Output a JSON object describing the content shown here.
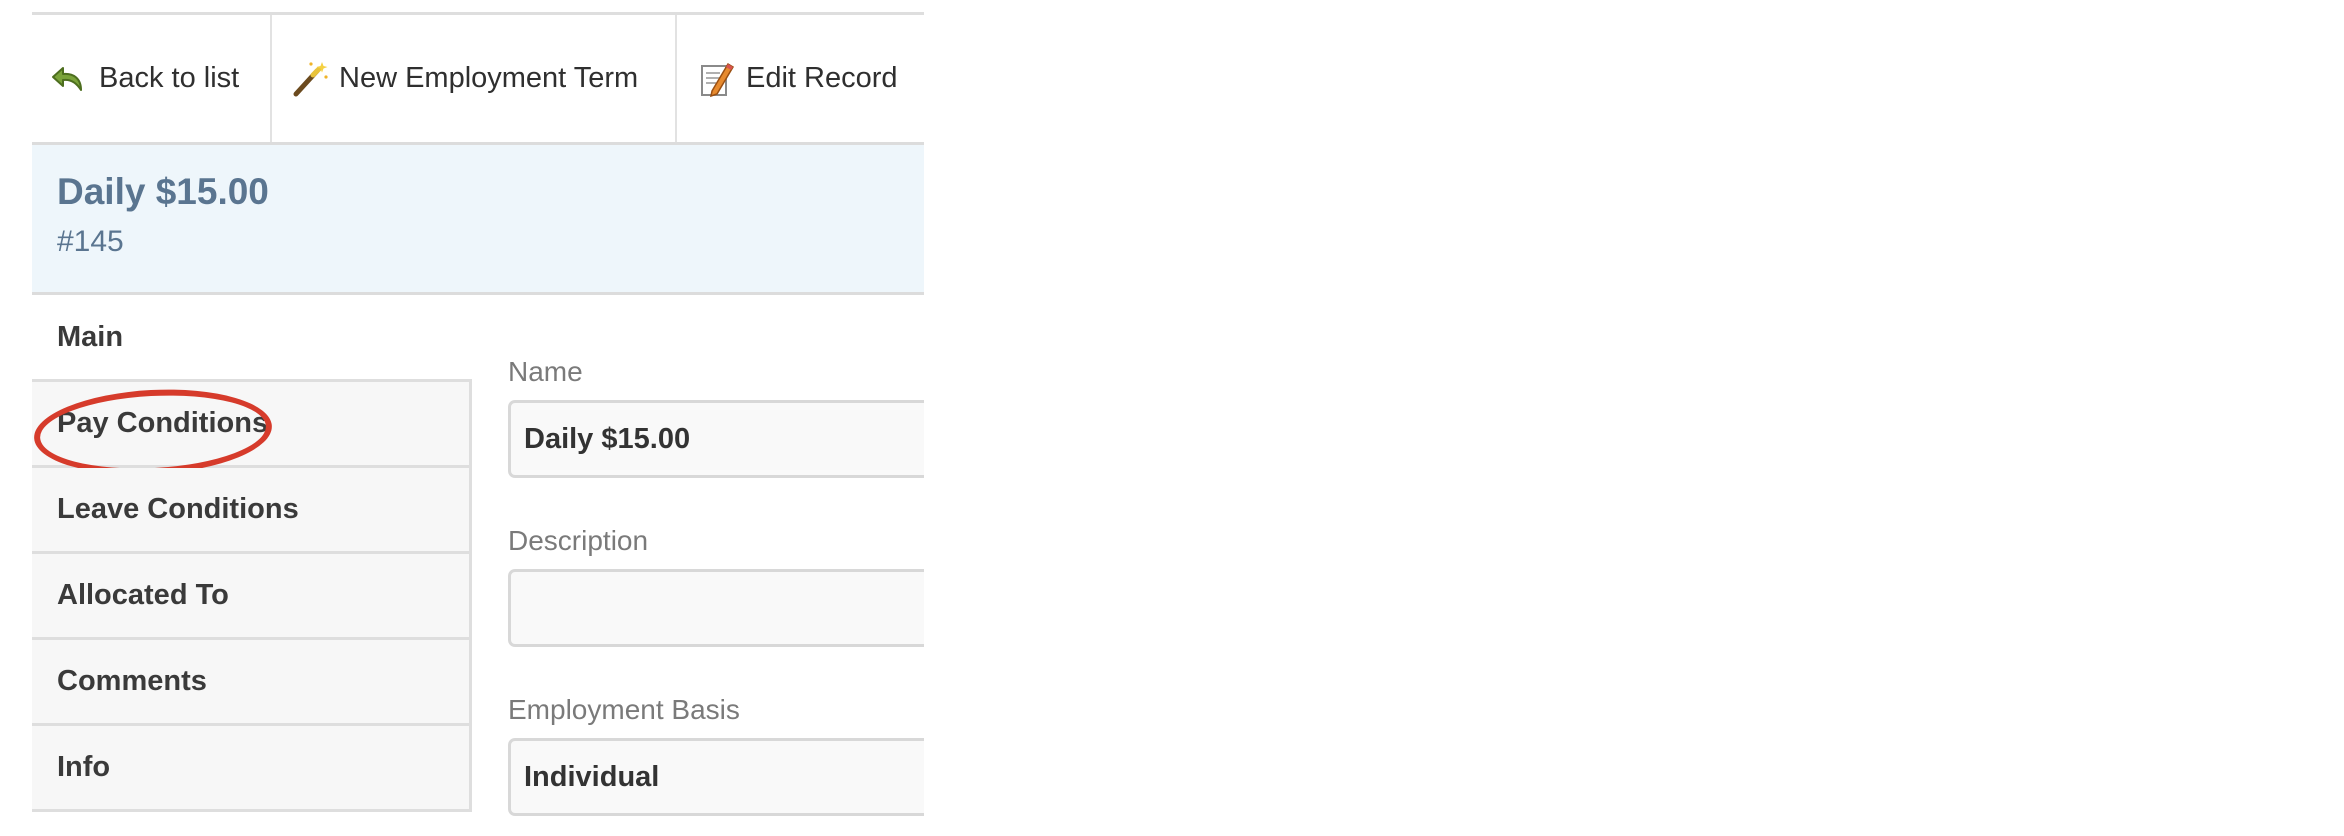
{
  "toolbar": {
    "back_label": "Back to list",
    "new_label": "New Employment Term",
    "edit_label": "Edit Record",
    "icons": {
      "back": "undo-arrow-icon",
      "new": "magic-wand-icon",
      "edit": "pencil-document-icon"
    }
  },
  "record": {
    "title": "Daily $15.00",
    "id": "#145"
  },
  "tabs": [
    {
      "label": "Main",
      "active": true
    },
    {
      "label": "Pay Conditions",
      "highlighted": true
    },
    {
      "label": "Leave Conditions"
    },
    {
      "label": "Allocated To"
    },
    {
      "label": "Comments"
    },
    {
      "label": "Info"
    }
  ],
  "form": {
    "name_label": "Name",
    "name_value": "Daily $15.00",
    "description_label": "Description",
    "description_value": "",
    "basis_label": "Employment Basis",
    "basis_value": "Individual"
  },
  "colors": {
    "header_bg": "#eef6fb",
    "title_text": "#5a7590",
    "highlight_ring": "#d63b2b"
  }
}
